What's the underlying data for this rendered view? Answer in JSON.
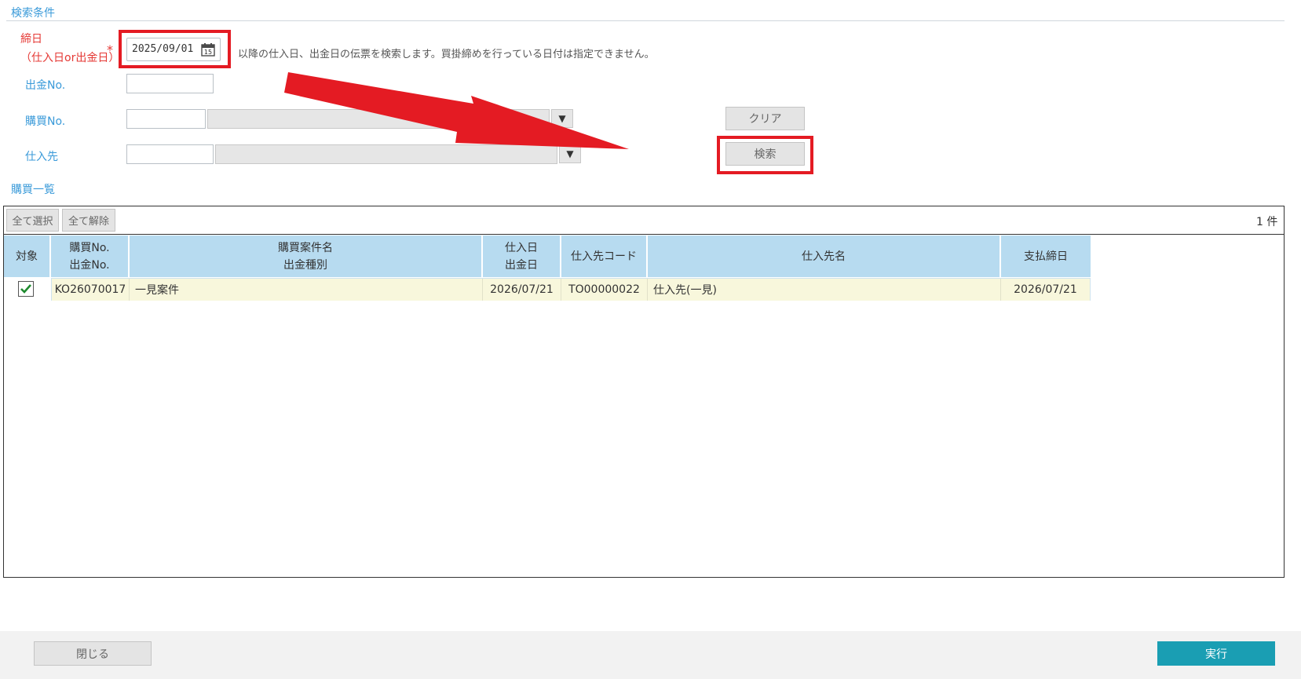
{
  "search": {
    "section_title": "検索条件",
    "closing_date_label_1": "締日",
    "closing_date_label_2": "（仕入日or出金日）",
    "required_mark": "*",
    "closing_date_value": "2025/09/01",
    "calendar_day": "15",
    "note": "以降の仕入日、出金日の伝票を検索します。買掛締めを行っている日付は指定できません。",
    "payment_no_label": "出金No.",
    "purchase_no_label": "購買No.",
    "supplier_label": "仕入先",
    "clear_label": "クリア",
    "search_label": "検索",
    "dropdown_glyph": "▼"
  },
  "list": {
    "section_title": "購買一覧",
    "select_all_label": "全て選択",
    "deselect_all_label": "全て解除",
    "count_label": "1 件",
    "headers": {
      "target": "対象",
      "purchase_no": "購買No.",
      "payment_no": "出金No.",
      "case_name": "購買案件名",
      "payment_type": "出金種別",
      "purchase_date": "仕入日",
      "payment_date": "出金日",
      "supplier_code": "仕入先コード",
      "supplier_name": "仕入先名",
      "closing_date": "支払締日"
    },
    "rows": [
      {
        "checked": true,
        "purchase_no": "KO26070017",
        "case_name": "一見案件",
        "purchase_date": "2026/07/21",
        "supplier_code": "TO00000022",
        "supplier_name": "仕入先(一見)",
        "closing_date": "2026/07/21"
      }
    ]
  },
  "footer": {
    "close_label": "閉じる",
    "execute_label": "実行"
  },
  "colors": {
    "accent_blue": "#3a9ad9",
    "header_blue": "#b7dbf0",
    "row_highlight": "#f8f7dc",
    "execute_teal": "#1a9eb3",
    "annotation_red": "#e41b23"
  }
}
